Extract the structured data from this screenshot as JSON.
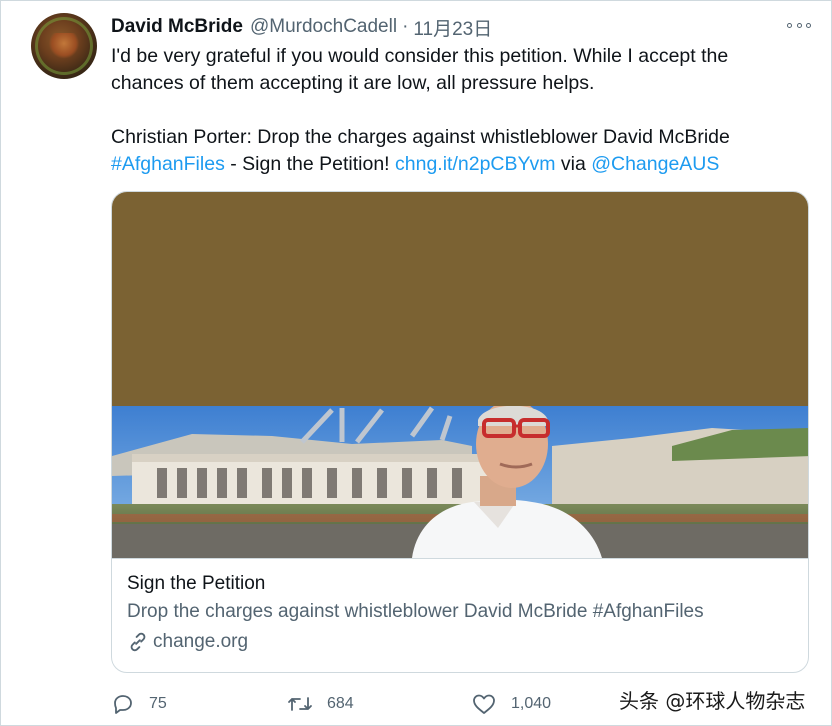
{
  "tweet": {
    "author_name": "David McBride",
    "handle": "@MurdochCadell",
    "separator": "·",
    "date": "11月23日",
    "text_line1": "I'd be very grateful if you would consider this petition. While I accept the",
    "text_line2": "chances of them accepting it are low, all pressure helps.",
    "text_line3": "Christian Porter: Drop the charges against whistleblower David McBride",
    "hashtag": "#AfghanFiles",
    "text_mid": " - Sign the Petition! ",
    "short_link": "chng.it/n2pCBYvm",
    "via": " via ",
    "mention": "@ChangeAUS"
  },
  "card": {
    "title": "Sign the Petition",
    "description": "Drop the charges against whistleblower David McBride #AfghanFiles",
    "domain": "change.org"
  },
  "actions": {
    "reply_count": "75",
    "retweet_count": "684",
    "like_count": "1,040"
  },
  "watermark": "头条 @环球人物杂志",
  "colors": {
    "link": "#1d9bf0",
    "secondary_text": "#536471",
    "primary_text": "#0f1419",
    "card_banner": "#7b6233"
  },
  "icons": [
    "more-icon",
    "link-icon",
    "reply-icon",
    "retweet-icon",
    "like-icon"
  ]
}
